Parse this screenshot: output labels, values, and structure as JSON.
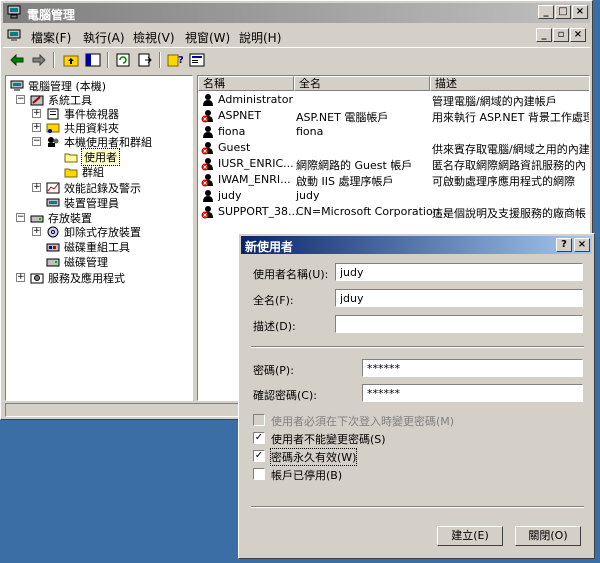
{
  "window": {
    "title": "電腦管理",
    "buttons": [
      "_",
      "□",
      "×"
    ]
  },
  "menu": [
    {
      "label": "檔案(F)"
    },
    {
      "label": "執行(A)"
    },
    {
      "label": "檢視(V)"
    },
    {
      "label": "視窗(W)"
    },
    {
      "label": "說明(H)"
    }
  ],
  "mdi_buttons": [
    "_",
    "▫",
    "×"
  ],
  "tree": [
    {
      "label": "電腦管理 (本機)"
    },
    {
      "label": "系統工具"
    },
    {
      "label": "事件檢視器"
    },
    {
      "label": "共用資料夾"
    },
    {
      "label": "本機使用者和群組"
    },
    {
      "label": "使用者"
    },
    {
      "label": "群組"
    },
    {
      "label": "效能記錄及警示"
    },
    {
      "label": "裝置管理員"
    },
    {
      "label": "存放裝置"
    },
    {
      "label": "卸除式存放裝置"
    },
    {
      "label": "磁碟重組工具"
    },
    {
      "label": "磁碟管理"
    },
    {
      "label": "服務及應用程式"
    }
  ],
  "list": {
    "columns": [
      "名稱",
      "全名",
      "描述"
    ],
    "rows": [
      {
        "name": "Administrator",
        "fullname": "",
        "desc": "管理電腦/網域的內建帳戶"
      },
      {
        "name": "ASPNET",
        "fullname": "ASP.NET 電腦帳戶",
        "desc": "用來執行 ASP.NET 背景工作處理"
      },
      {
        "name": "fiona",
        "fullname": "fiona",
        "desc": ""
      },
      {
        "name": "Guest",
        "fullname": "",
        "desc": "供來賓存取電腦/網域之用的內建"
      },
      {
        "name": "IUSR_ENRIC...",
        "fullname": "網際網路的 Guest 帳戶",
        "desc": "匿名存取網際網路資訊服務的內"
      },
      {
        "name": "IWAM_ENRI...",
        "fullname": "啟動 IIS 處理序帳戶",
        "desc": "可啟動處理序應用程式的網際"
      },
      {
        "name": "judy",
        "fullname": "judy",
        "desc": ""
      },
      {
        "name": "SUPPORT_38...",
        "fullname": "CN=Microsoft Corporation...",
        "desc": "這是個說明及支援服務的廠商帳"
      }
    ]
  },
  "dialog": {
    "title": "新使用者",
    "help": "?",
    "close": "×",
    "username_label": "使用者名稱(U):",
    "username_value": "judy",
    "fullname_label": "全名(F):",
    "fullname_value": "jduy",
    "desc_label": "描述(D):",
    "desc_value": "",
    "password_label": "密碼(P):",
    "password_value": "******",
    "confirm_label": "確認密碼(C):",
    "confirm_value": "******",
    "options": [
      {
        "label": "使用者必須在下次登入時變更密碼(M)",
        "checked": false,
        "disabled": true
      },
      {
        "label": "使用者不能變更密碼(S)",
        "checked": true,
        "disabled": false
      },
      {
        "label": "密碼永久有效(W)",
        "checked": true,
        "disabled": false
      },
      {
        "label": "帳戶已停用(B)",
        "checked": false,
        "disabled": false
      }
    ],
    "create_button": "建立(E)",
    "close_button": "關閉(O)"
  }
}
